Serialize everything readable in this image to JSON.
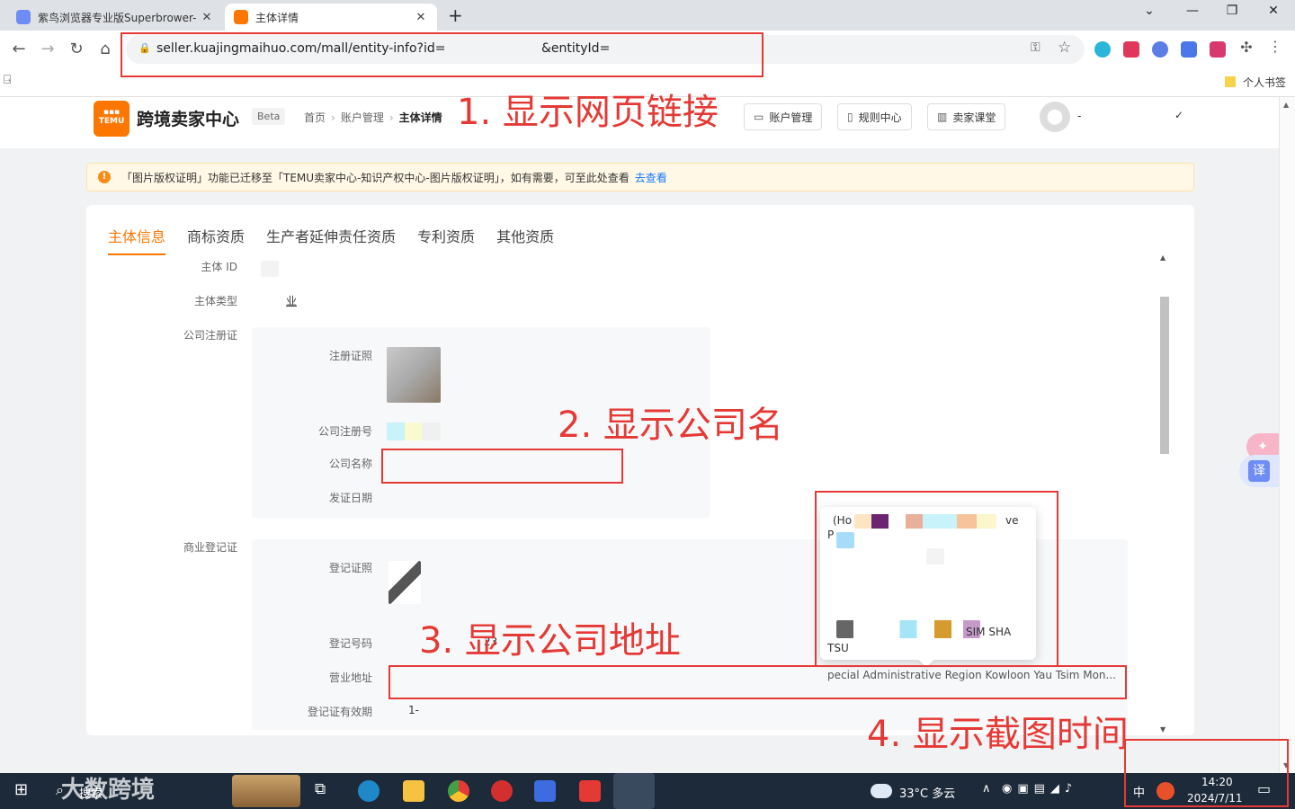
{
  "browser": {
    "tabs": [
      {
        "title": "紫鸟浏览器专业版Superbrower-"
      },
      {
        "title": "主体详情"
      }
    ],
    "url_prefix": "seller.kuajingmaihuo.com/mall/entity-info?id=",
    "url_suffix": "&entityId=",
    "bookmark_folder": "个人书签"
  },
  "header": {
    "logo_text": "TEMU",
    "brand": "跨境卖家中心",
    "beta": "Beta",
    "breadcrumb": [
      "首页",
      "账户管理",
      "主体详情"
    ],
    "buttons": [
      "账户管理",
      "规则中心",
      "卖家课堂"
    ],
    "user_name": "-",
    "check": "✓"
  },
  "notice": {
    "text": "「图片版权证明」功能已迁移至「TEMU卖家中心-知识产权中心-图片版权证明」，如有需要，可至此处查看",
    "link": "去查看"
  },
  "tabs": [
    "主体信息",
    "商标资质",
    "生产者延伸责任资质",
    "专利资质",
    "其他资质"
  ],
  "active_tab": 0,
  "fields": {
    "entity_id": "主体 ID",
    "entity_type": "主体类型",
    "entity_type_value": "业",
    "company_registration": "公司注册证",
    "reg_certificate": "注册证照",
    "company_reg_no": "公司注册号",
    "company_name": "公司名称",
    "issue_date": "发证日期",
    "business_registration": "商业登记证",
    "biz_certificate": "登记证照",
    "biz_reg_no": "登记号码",
    "biz_reg_no_value": "23",
    "business_address": "营业地址",
    "business_address_value": "pecial Administrative Region Kowloon Yau Tsim Mon...",
    "biz_validity": "登记证有效期",
    "biz_validity_value": "1-"
  },
  "popover": {
    "line1": "(Ho",
    "line1_end": "ve",
    "line2": "P",
    "line3": "SIM SHA",
    "line4": "TSU"
  },
  "annotations": [
    "1. 显示网页链接",
    "2. 显示公司名",
    "3. 显示公司地址",
    "4. 显示截图时间"
  ],
  "taskbar": {
    "search": "搜索",
    "weather": "33°C 多云",
    "ime": "中",
    "time": "14:20",
    "date": "2024/7/11",
    "brand_watermark": "大数跨境"
  },
  "colors": {
    "accent": "#fb7701",
    "annotation": "#e53935",
    "link": "#1677ff"
  }
}
